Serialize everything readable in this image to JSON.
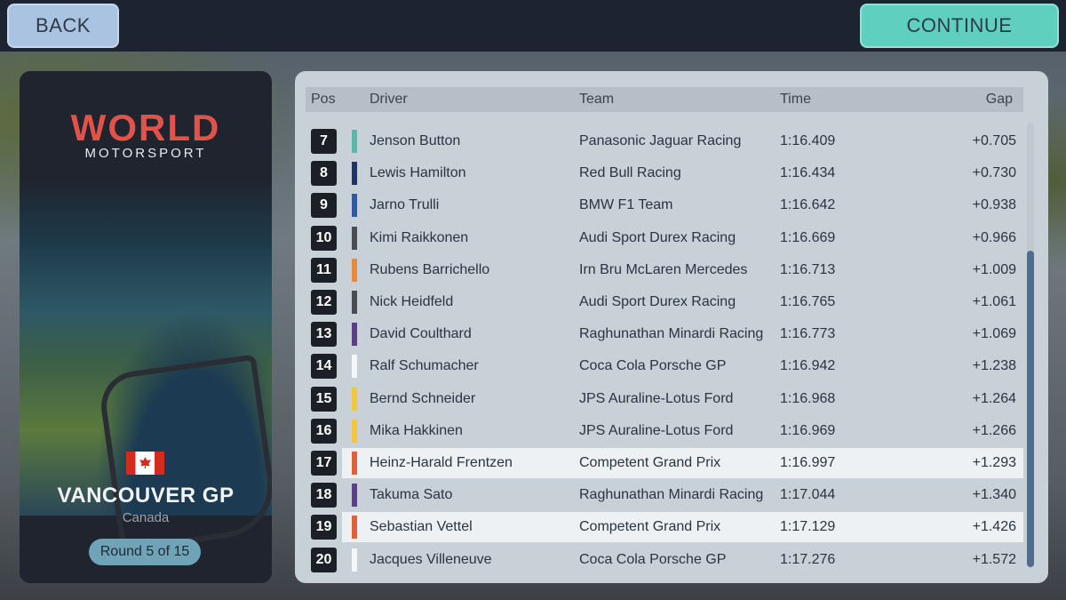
{
  "header": {
    "back_label": "BACK",
    "continue_label": "CONTINUE"
  },
  "event": {
    "logo_top": "WORLD",
    "logo_bottom": "MOTORSPORT",
    "name": "VANCOUVER GP",
    "country": "Canada",
    "round": "Round 5 of 15"
  },
  "table": {
    "columns": [
      "Pos",
      "Driver",
      "Team",
      "Time",
      "Gap"
    ],
    "rows": [
      {
        "pos": "7",
        "driver": "Jenson Button",
        "team": "Panasonic Jaguar Racing",
        "time": "1:16.409",
        "gap": "+0.705",
        "color": "#5bb8a8"
      },
      {
        "pos": "8",
        "driver": "Lewis Hamilton",
        "team": "Red Bull Racing",
        "time": "1:16.434",
        "gap": "+0.730",
        "color": "#1f3566"
      },
      {
        "pos": "9",
        "driver": "Jarno Trulli",
        "team": "BMW F1 Team",
        "time": "1:16.642",
        "gap": "+0.938",
        "color": "#2f5aa0"
      },
      {
        "pos": "10",
        "driver": "Kimi Raikkonen",
        "team": "Audi Sport Durex Racing",
        "time": "1:16.669",
        "gap": "+0.966",
        "color": "#4a4d52"
      },
      {
        "pos": "11",
        "driver": "Rubens Barrichello",
        "team": "Irn Bru McLaren Mercedes",
        "time": "1:16.713",
        "gap": "+1.009",
        "color": "#e88a3a"
      },
      {
        "pos": "12",
        "driver": "Nick Heidfeld",
        "team": "Audi Sport Durex Racing",
        "time": "1:16.765",
        "gap": "+1.061",
        "color": "#4a4d52"
      },
      {
        "pos": "13",
        "driver": "David Coulthard",
        "team": "Raghunathan Minardi Racing",
        "time": "1:16.773",
        "gap": "+1.069",
        "color": "#5b3f8c"
      },
      {
        "pos": "14",
        "driver": "Ralf Schumacher",
        "team": "Coca Cola Porsche GP",
        "time": "1:16.942",
        "gap": "+1.238",
        "color": "#f4f6f8"
      },
      {
        "pos": "15",
        "driver": "Bernd Schneider",
        "team": "JPS Auraline-Lotus Ford",
        "time": "1:16.968",
        "gap": "+1.264",
        "color": "#f0c93a"
      },
      {
        "pos": "16",
        "driver": "Mika Hakkinen",
        "team": "JPS Auraline-Lotus Ford",
        "time": "1:16.969",
        "gap": "+1.266",
        "color": "#f0c93a"
      },
      {
        "pos": "17",
        "driver": "Heinz-Harald Frentzen",
        "team": "Competent Grand Prix",
        "time": "1:16.997",
        "gap": "+1.293",
        "color": "#e0603a",
        "highlight": true
      },
      {
        "pos": "18",
        "driver": "Takuma Sato",
        "team": "Raghunathan Minardi Racing",
        "time": "1:17.044",
        "gap": "+1.340",
        "color": "#5b3f8c"
      },
      {
        "pos": "19",
        "driver": "Sebastian Vettel",
        "team": "Competent Grand Prix",
        "time": "1:17.129",
        "gap": "+1.426",
        "color": "#e0603a",
        "highlight": true
      },
      {
        "pos": "20",
        "driver": "Jacques Villeneuve",
        "team": "Coca Cola Porsche GP",
        "time": "1:17.276",
        "gap": "+1.572",
        "color": "#f4f6f8"
      }
    ]
  },
  "colors": {
    "back_button": "#a9c3e0",
    "continue_button": "#5fd0c0",
    "logo_red": "#e0524a",
    "round_badge": "#6fa3b8"
  }
}
